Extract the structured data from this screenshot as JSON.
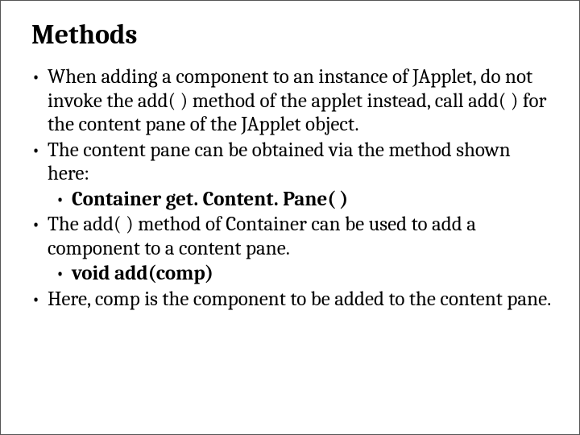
{
  "title": "Methods",
  "bullets": {
    "b1": "When adding a component to an instance of JApplet, do not invoke the add( ) method of the applet instead, call add( ) for the content pane of the JApplet object.",
    "b2": "The content pane can be obtained via the method shown here:",
    "b2a": "Container get. Content. Pane( )",
    "b3": "The add( ) method of Container can be used to add a component to a content pane.",
    "b3a": "void add(comp)",
    "b4": "Here, comp is the component to be added to the content pane."
  },
  "marker": "•"
}
